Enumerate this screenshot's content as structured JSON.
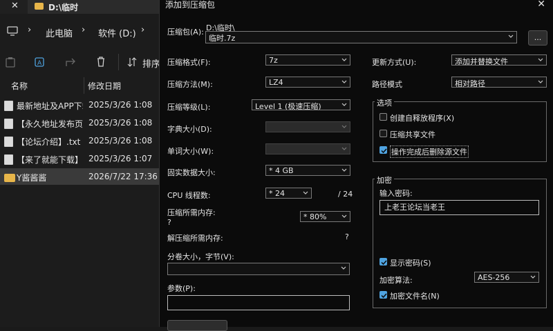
{
  "explorer": {
    "tab_close": "✕",
    "tab_title": "D:\\临时",
    "breadcrumb": [
      "此电脑",
      "软件 (D:)"
    ],
    "sort_label": "排序",
    "columns": {
      "name": "名称",
      "modified": "修改日期"
    },
    "files": [
      {
        "name": "最新地址及APP下载.txt",
        "date": "2025/3/26 1:08",
        "type": "file"
      },
      {
        "name": "【永久地址发布页】.txt",
        "date": "2025/3/26 1:08",
        "type": "file"
      },
      {
        "name": "【论坛介绍】.txt",
        "date": "2025/3/26 1:08",
        "type": "file"
      },
      {
        "name": "【来了就能下载】.txt",
        "date": "2025/3/26 1:07",
        "type": "file"
      },
      {
        "name": "Y酱酱酱",
        "date": "2026/7/22 17:36",
        "type": "folder"
      }
    ]
  },
  "dialog": {
    "title": "添加到压缩包",
    "close": "✕",
    "archive_label": "压缩包(A):",
    "archive_dir": "D:\\临时\\",
    "archive_name": "临时.7z",
    "browse_label": "...",
    "format": {
      "label": "压缩格式(F):",
      "value": "7z"
    },
    "method": {
      "label": "压缩方法(M):",
      "value": "LZ4"
    },
    "level": {
      "label": "压缩等级(L):",
      "value": "Level 1 (极速压缩)"
    },
    "dict": {
      "label": "字典大小(D):",
      "value": ""
    },
    "word": {
      "label": "单词大小(W):",
      "value": ""
    },
    "solid": {
      "label": "固实数据大小:",
      "value": "* 4 GB"
    },
    "threads": {
      "label": "CPU 线程数:",
      "value": "* 24",
      "max": "/ 24"
    },
    "mem": {
      "label": "压缩所需内存:",
      "value": "* 80%",
      "q": "?"
    },
    "demem": {
      "label": "解压缩所需内存:",
      "q": "?"
    },
    "volume": {
      "label": "分卷大小，字节(V):",
      "value": ""
    },
    "params": {
      "label": "参数(P):",
      "value": ""
    },
    "update": {
      "label": "更新方式(U):",
      "value": "添加并替换文件"
    },
    "pathmode": {
      "label": "路径模式",
      "value": "相对路径"
    },
    "options": {
      "title": "选项",
      "sfx": {
        "label": "创建自释放程序(X)",
        "checked": false
      },
      "shared": {
        "label": "压缩共享文件",
        "checked": false
      },
      "delete": {
        "label": "操作完成后删除源文件",
        "checked": true
      }
    },
    "encrypt": {
      "title": "加密",
      "pw_label": "输入密码:",
      "pw_value": "上老王论坛当老王",
      "show_pw": {
        "label": "显示密码(S)",
        "checked": true
      },
      "algo_label": "加密算法:",
      "algo_value": "AES-256",
      "enc_names": {
        "label": "加密文件名(N)",
        "checked": true
      }
    }
  }
}
